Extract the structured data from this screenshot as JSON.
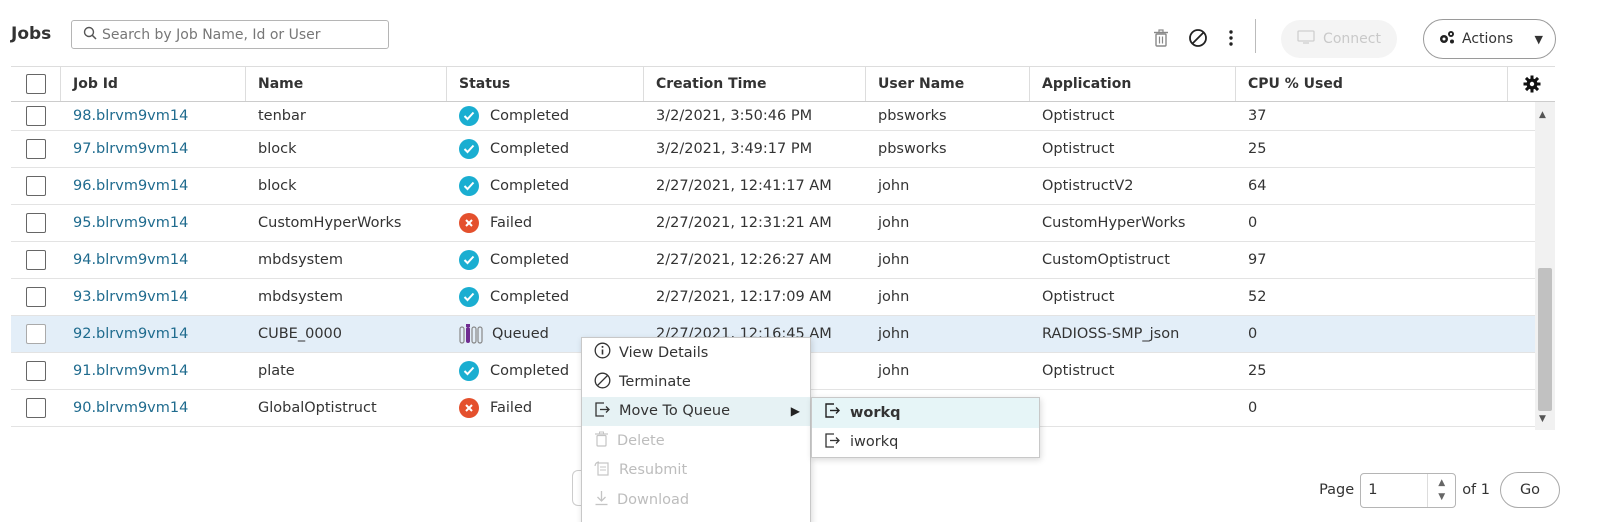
{
  "page": {
    "title": "Jobs"
  },
  "search": {
    "placeholder": "Search by Job Name, Id or User"
  },
  "toolbar": {
    "delete_icon": "trash-icon",
    "terminate_icon": "ban-icon",
    "more_icon": "more-vertical-icon",
    "connect_label": "Connect",
    "actions_label": "Actions"
  },
  "table": {
    "columns": [
      "Job Id",
      "Name",
      "Status",
      "Creation Time",
      "User Name",
      "Application",
      "CPU % Used"
    ],
    "rows": [
      {
        "id": "98.blrvm9vm14",
        "name": "tenbar",
        "status": "Completed",
        "ctime": "3/2/2021, 3:50:46 PM",
        "user": "pbsworks",
        "app": "Optistruct",
        "cpu": "37"
      },
      {
        "id": "97.blrvm9vm14",
        "name": "block",
        "status": "Completed",
        "ctime": "3/2/2021, 3:49:17 PM",
        "user": "pbsworks",
        "app": "Optistruct",
        "cpu": "25"
      },
      {
        "id": "96.blrvm9vm14",
        "name": "block",
        "status": "Completed",
        "ctime": "2/27/2021, 12:41:17 AM",
        "user": "john",
        "app": "OptistructV2",
        "cpu": "64"
      },
      {
        "id": "95.blrvm9vm14",
        "name": "CustomHyperWorks",
        "status": "Failed",
        "ctime": "2/27/2021, 12:31:21 AM",
        "user": "john",
        "app": "CustomHyperWorks",
        "cpu": "0"
      },
      {
        "id": "94.blrvm9vm14",
        "name": "mbdsystem",
        "status": "Completed",
        "ctime": "2/27/2021, 12:26:27 AM",
        "user": "john",
        "app": "CustomOptistruct",
        "cpu": "97"
      },
      {
        "id": "93.blrvm9vm14",
        "name": "mbdsystem",
        "status": "Completed",
        "ctime": "2/27/2021, 12:17:09 AM",
        "user": "john",
        "app": "Optistruct",
        "cpu": "52"
      },
      {
        "id": "92.blrvm9vm14",
        "name": "CUBE_0000",
        "status": "Queued",
        "ctime": "2/27/2021, 12:16:45 AM",
        "user": "john",
        "app": "RADIOSS-SMP_json",
        "cpu": "0"
      },
      {
        "id": "91.blrvm9vm14",
        "name": "plate",
        "status": "Completed",
        "ctime": "",
        "user": "john",
        "app": "Optistruct",
        "cpu": "25"
      },
      {
        "id": "90.blrvm9vm14",
        "name": "GlobalOptistruct",
        "status": "Failed",
        "ctime": "",
        "user": "",
        "app": "",
        "cpu": "0"
      }
    ]
  },
  "context_menu": {
    "items": [
      {
        "label": "View Details",
        "icon": "info-icon"
      },
      {
        "label": "Terminate",
        "icon": "ban-icon"
      },
      {
        "label": "Move To Queue",
        "icon": "move-queue-icon"
      },
      {
        "label": "Delete",
        "icon": "trash-icon"
      },
      {
        "label": "Resubmit",
        "icon": "resubmit-icon"
      },
      {
        "label": "Download",
        "icon": "download-icon"
      }
    ],
    "submenu": [
      {
        "label": "workq",
        "icon": "move-queue-icon"
      },
      {
        "label": "iworkq",
        "icon": "move-queue-icon"
      }
    ]
  },
  "pagination": {
    "page_label": "Page",
    "page_value": "1",
    "of_label": "of 1",
    "go_label": "Go"
  },
  "colors": {
    "link": "#1f6b8e",
    "completed": "#1aaed1",
    "failed": "#e4502d",
    "selected_row": "#e3eef8",
    "menu_hover": "#e6f2f4"
  }
}
